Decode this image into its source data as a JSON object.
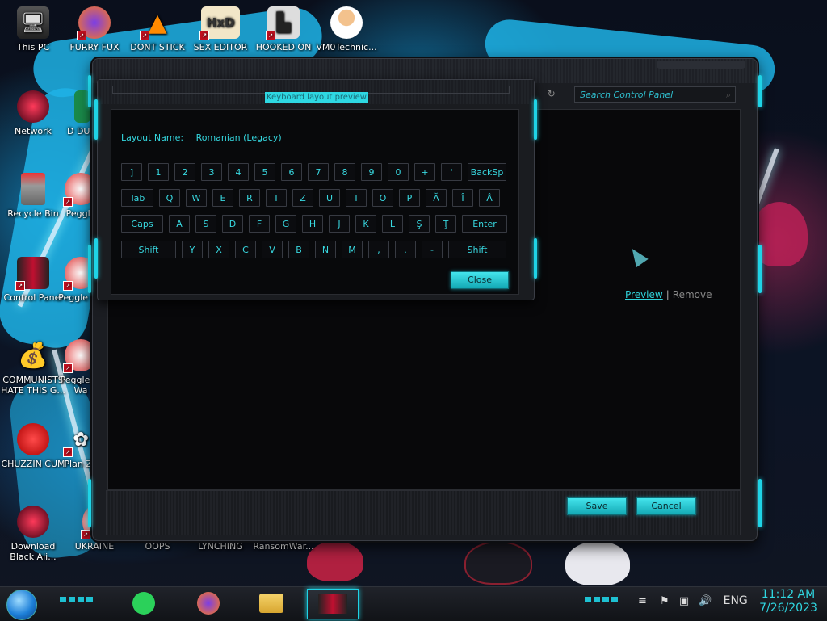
{
  "desktop_icons": [
    {
      "label": "This PC",
      "icon": "this-pc-icon"
    },
    {
      "label": "FURRY FUX",
      "icon": "firefox-icon"
    },
    {
      "label": "DONT STICK",
      "icon": "vlc-cone-icon"
    },
    {
      "label": "SEX EDITOR",
      "icon": "hxd-icon"
    },
    {
      "label": "HOOKED ON",
      "icon": "maze-icon"
    },
    {
      "label": "VM0Technic...",
      "icon": "doctor-icon"
    },
    {
      "label": "Network",
      "icon": "network-icon"
    },
    {
      "label": "D DUM",
      "icon": "document-icon"
    },
    {
      "label": "Recycle Bin",
      "icon": "recycle-bin-icon"
    },
    {
      "label": "Peggle",
      "icon": "peggle-icon"
    },
    {
      "label": "Control Panel",
      "icon": "control-panel-icon"
    },
    {
      "label": "Peggle De",
      "icon": "peggle-deluxe-icon"
    },
    {
      "label": "COMMUNISTS HATE THIS G...",
      "icon": "money-bag-icon"
    },
    {
      "label": "Peggle of Wa",
      "icon": "peggle-nights-icon"
    },
    {
      "label": "CHUZZIN CUM",
      "icon": "chuzzle-icon"
    },
    {
      "label": "Plan Zo",
      "icon": "plants-zombies-icon"
    },
    {
      "label": "Download Black Ali...",
      "icon": "download-icon"
    },
    {
      "label": "UKRAINE",
      "icon": "ukraine-icon"
    },
    {
      "label": "OOPS",
      "icon": "oops-icon"
    },
    {
      "label": "LYNCHING",
      "icon": "lynching-icon"
    },
    {
      "label": "RansomWar...",
      "icon": "ransomware-icon"
    }
  ],
  "control_panel": {
    "search_placeholder": "Search Control Panel",
    "preview_link": "Preview",
    "separator": "|",
    "remove_link": "Remove",
    "save_label": "Save",
    "cancel_label": "Cancel"
  },
  "keyboard_preview": {
    "title": "Keyboard layout preview",
    "layout_name_label": "Layout Name:",
    "layout_name_value": "Romanian (Legacy)",
    "close_label": "Close",
    "rows": [
      [
        "]",
        "1",
        "2",
        "3",
        "4",
        "5",
        "6",
        "7",
        "8",
        "9",
        "0",
        "+",
        "'",
        "BackSp"
      ],
      [
        "Tab",
        "Q",
        "W",
        "E",
        "R",
        "T",
        "Z",
        "U",
        "I",
        "O",
        "P",
        "Ă",
        "Î",
        "Â"
      ],
      [
        "Caps",
        "A",
        "S",
        "D",
        "F",
        "G",
        "H",
        "J",
        "K",
        "L",
        "Ş",
        "Ţ",
        "Enter"
      ],
      [
        "Shift",
        "Y",
        "X",
        "C",
        "V",
        "B",
        "N",
        "M",
        ",",
        ".",
        "-",
        "Shift"
      ]
    ]
  },
  "taskbar": {
    "items": [
      {
        "name": "notes-app",
        "icon": "green-notes-icon"
      },
      {
        "name": "firefox",
        "icon": "firefox-icon"
      },
      {
        "name": "file-explorer",
        "icon": "folder-icon"
      },
      {
        "name": "control-panel",
        "icon": "control-panel-icon"
      }
    ],
    "language": "ENG",
    "time": "11:12 AM",
    "date": "7/26/2023"
  },
  "colors": {
    "accent": "#1fd3e6",
    "window_bg": "#1b1d22",
    "content_bg": "#08080a"
  }
}
